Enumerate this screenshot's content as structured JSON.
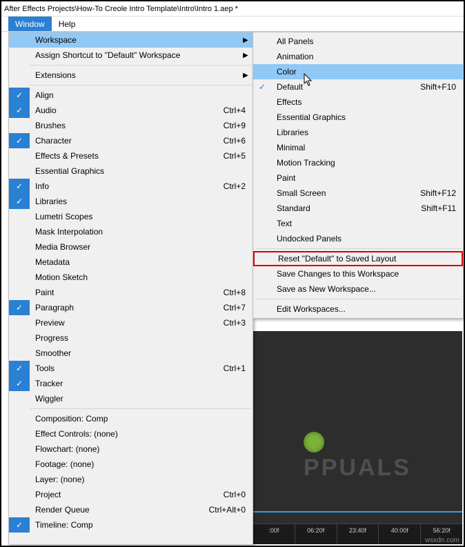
{
  "title": "After Effects Projects\\How-To Creole Intro Template\\Intro\\Intro 1.aep *",
  "menubar": {
    "window": "Window",
    "help": "Help"
  },
  "window_menu": {
    "workspace": "Workspace",
    "assign_shortcut": "Assign Shortcut to \"Default\" Workspace",
    "extensions": "Extensions",
    "align": "Align",
    "audio": "Audio",
    "audio_sc": "Ctrl+4",
    "brushes": "Brushes",
    "brushes_sc": "Ctrl+9",
    "character": "Character",
    "character_sc": "Ctrl+6",
    "effects_presets": "Effects & Presets",
    "effects_presets_sc": "Ctrl+5",
    "essential_graphics": "Essential Graphics",
    "info": "Info",
    "info_sc": "Ctrl+2",
    "libraries": "Libraries",
    "lumetri": "Lumetri Scopes",
    "mask_interp": "Mask Interpolation",
    "media_browser": "Media Browser",
    "metadata": "Metadata",
    "motion_sketch": "Motion Sketch",
    "paint": "Paint",
    "paint_sc": "Ctrl+8",
    "paragraph": "Paragraph",
    "paragraph_sc": "Ctrl+7",
    "preview": "Preview",
    "preview_sc": "Ctrl+3",
    "progress": "Progress",
    "smoother": "Smoother",
    "tools": "Tools",
    "tools_sc": "Ctrl+1",
    "tracker": "Tracker",
    "wiggler": "Wiggler",
    "composition": "Composition: Comp",
    "effect_controls": "Effect Controls: (none)",
    "flowchart": "Flowchart: (none)",
    "footage": "Footage: (none)",
    "layer": "Layer: (none)",
    "project": "Project",
    "project_sc": "Ctrl+0",
    "render_queue": "Render Queue",
    "render_queue_sc": "Ctrl+Alt+0",
    "timeline": "Timeline: Comp"
  },
  "workspace_submenu": {
    "all_panels": "All Panels",
    "animation": "Animation",
    "color": "Color",
    "default": "Default",
    "default_sc": "Shift+F10",
    "effects": "Effects",
    "essential_graphics": "Essential Graphics",
    "libraries": "Libraries",
    "minimal": "Minimal",
    "motion_tracking": "Motion Tracking",
    "paint": "Paint",
    "small_screen": "Small Screen",
    "small_screen_sc": "Shift+F12",
    "standard": "Standard",
    "standard_sc": "Shift+F11",
    "text": "Text",
    "undocked": "Undocked Panels",
    "reset": "Reset \"Default\" to Saved Layout",
    "save_changes": "Save Changes to this Workspace",
    "save_as_new": "Save as New Workspace...",
    "edit_workspaces": "Edit Workspaces..."
  },
  "timeline": {
    "ticks": [
      ":00f",
      "06:20f",
      "23:40f",
      "40:00f",
      "56:20f"
    ]
  },
  "source": "wsxdn.com"
}
